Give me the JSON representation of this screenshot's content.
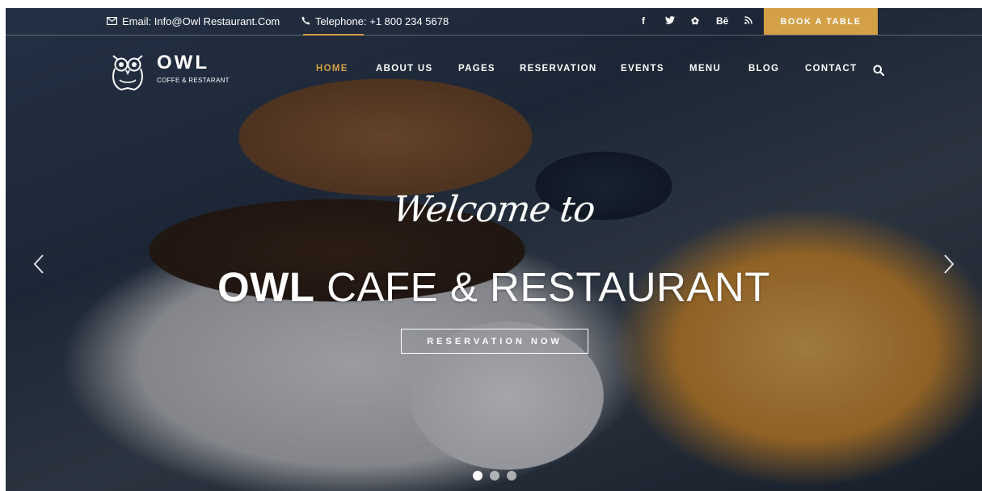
{
  "topbar": {
    "email": "Email: Info@Owl Restaurant.Com",
    "phone": "Telephone: +1 800 234 5678",
    "social": [
      "f",
      "t",
      "✿",
      "Bē",
      "rss"
    ],
    "book_label": "BOOK A TABLE"
  },
  "logo": {
    "name": "OWL",
    "tagline": "COFFE & RESTARANT"
  },
  "nav": {
    "items": [
      {
        "label": "HOME",
        "active": true
      },
      {
        "label": "ABOUT US",
        "active": false
      },
      {
        "label": "PAGES",
        "active": false
      },
      {
        "label": "RESERVATION",
        "active": false
      },
      {
        "label": "EVENTS",
        "active": false
      },
      {
        "label": "MENU",
        "active": false
      },
      {
        "label": "BLOG",
        "active": false
      },
      {
        "label": "CONTACT",
        "active": false
      }
    ]
  },
  "hero": {
    "welcome": "Welcome to",
    "headline_bold": "OWL",
    "headline_rest": "CAFE & RESTAURANT",
    "cta_label": "RESERVATION NOW",
    "slides": 3,
    "active_slide": 1
  },
  "colors": {
    "accent": "#d4a046",
    "text": "#ffffff"
  },
  "icons": {
    "email": "envelope-icon",
    "phone": "phone-icon",
    "search": "search-icon",
    "prev": "chevron-left-icon",
    "next": "chevron-right-icon"
  }
}
